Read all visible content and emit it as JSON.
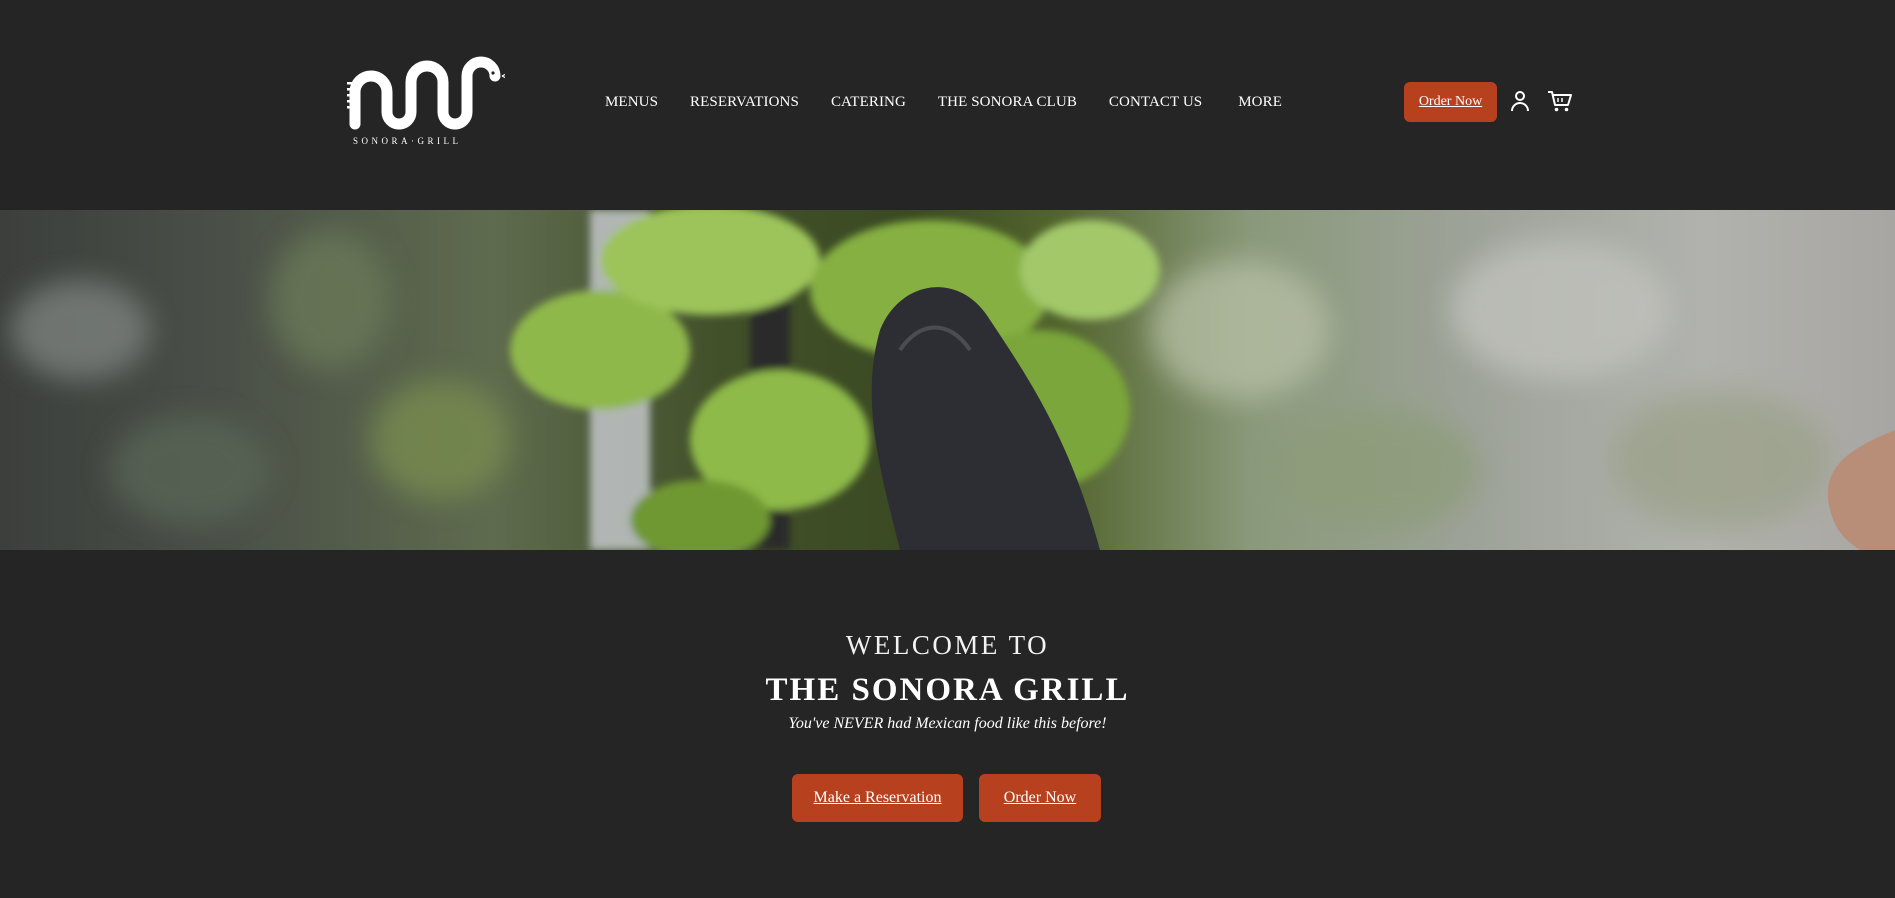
{
  "brand": {
    "name": "SONORA·GRILL",
    "logo_icon": "serpent-logo-icon"
  },
  "nav": {
    "items": [
      {
        "label": "MENUS"
      },
      {
        "label": "RESERVATIONS"
      },
      {
        "label": "CATERING"
      },
      {
        "label": "THE SONORA CLUB"
      },
      {
        "label": "CONTACT US"
      },
      {
        "label": "MORE"
      }
    ]
  },
  "header": {
    "order_label": "Order Now",
    "account_icon": "user-icon",
    "cart_icon": "shopping-cart-icon"
  },
  "hero": {
    "image": "hydroponic-lettuce-gloved-hand-photo"
  },
  "welcome": {
    "pre_title": "WELCOME TO",
    "title": "THE SONORA GRILL",
    "tagline": "You've NEVER had Mexican food like this before!",
    "reservation_label": "Make a Reservation",
    "order_label": "Order Now"
  },
  "colors": {
    "background": "#252525",
    "accent": "#b7411f",
    "text": "#ffffff"
  }
}
